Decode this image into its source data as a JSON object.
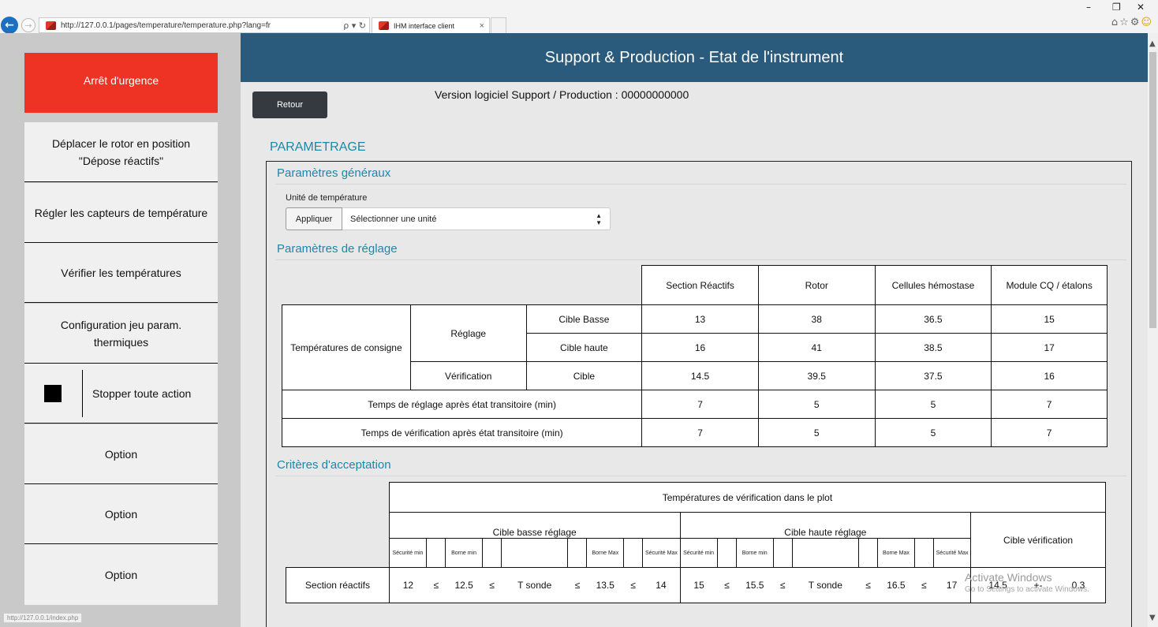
{
  "browser": {
    "url": "http://127.0.0.1/pages/temperature/temperature.php?lang=fr",
    "url_tools": "ρ ▾ ↻",
    "tab_title": "IHM interface client",
    "tab_close": "×",
    "minimize": "–",
    "restore": "❐",
    "close": "✕",
    "icons": "⌂☆⚙",
    "smile": "☺",
    "status_url": "http://127.0.0.1/index.php"
  },
  "sidebar": {
    "emergency": "Arrêt d'urgence",
    "items": [
      {
        "label": "Déplacer le rotor en position \"Dépose réactifs\""
      },
      {
        "label": "Régler les capteurs de température"
      },
      {
        "label": "Vérifier les températures"
      },
      {
        "label": "Configuration jeu param. thermiques"
      },
      {
        "label": "Stopper toute action"
      },
      {
        "label": "Option"
      },
      {
        "label": "Option"
      },
      {
        "label": "Option"
      }
    ]
  },
  "header": {
    "title": "Support & Production - Etat de l'instrument"
  },
  "main": {
    "back_label": "Retour",
    "version": "Version logiciel Support / Production : 00000000000",
    "parametrage_title": "PARAMETRAGE",
    "general": {
      "title": "Paramètres généraux",
      "unit_label": "Unité de température",
      "apply_label": "Appliquer",
      "select_value": "Sélectionner une unité"
    },
    "reglage": {
      "title": "Paramètres de réglage",
      "columns": [
        "Section Réactifs",
        "Rotor",
        "Cellules hémostase",
        "Module CQ / étalons"
      ],
      "temp_consigne": "Températures de consigne",
      "reglage_label": "Réglage",
      "verification_label": "Vérification",
      "cible_basse": "Cible Basse",
      "cible_haute": "Cible haute",
      "cible": "Cible",
      "rows": {
        "basse": [
          "13",
          "38",
          "36.5",
          "15"
        ],
        "haute": [
          "16",
          "41",
          "38.5",
          "17"
        ],
        "verif": [
          "14.5",
          "39.5",
          "37.5",
          "16"
        ],
        "temps_reglage": [
          "7",
          "5",
          "5",
          "7"
        ],
        "temps_verif": [
          "7",
          "5",
          "5",
          "7"
        ]
      },
      "temps_reglage_label": "Temps de réglage après état transitoire (min)",
      "temps_verif_label": "Temps de vérification après état transitoire (min)"
    },
    "criteres": {
      "title": "Critères d'acceptation",
      "main_header": "Températures de vérification dans le plot",
      "cible_basse_reglage": "Cible basse réglage",
      "cible_haute_reglage": "Cible haute réglage",
      "cible_verification": "Cible vérification",
      "sub_labels": {
        "secu_min": "Sécurité min",
        "borne_min": "Borne min",
        "borne_max": "Borne Max",
        "secu_max": "Sécurité Max"
      },
      "row_label": "Section réactifs",
      "le": "≤",
      "t_sonde": "T sonde",
      "pm": "+-",
      "basse_values": [
        "12",
        "12.5",
        "13.5",
        "14"
      ],
      "haute_values": [
        "15",
        "15.5",
        "16.5",
        "17"
      ],
      "verif_values": [
        "14.5",
        "0.3"
      ]
    }
  },
  "watermark": {
    "title": "Activate Windows",
    "subtitle": "Go to Settings to activate Windows."
  }
}
